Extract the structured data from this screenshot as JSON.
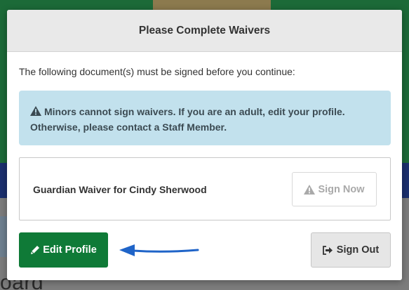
{
  "background": {
    "heading_fragment": "oard"
  },
  "modal": {
    "title": "Please Complete Waivers",
    "intro": "The following document(s) must be signed before you continue:",
    "alert": {
      "icon": "warning-icon",
      "text": "Minors cannot sign waivers. If you are an adult, edit your profile. Otherwise, please contact a Staff Member."
    },
    "waivers": [
      {
        "name": "Guardian Waiver for Cindy Sherwood",
        "action_label": "Sign Now",
        "action_icon": "warning-icon",
        "action_enabled": false
      }
    ],
    "buttons": {
      "edit_profile": {
        "label": "Edit Profile",
        "icon": "pencil-icon"
      },
      "sign_out": {
        "label": "Sign Out",
        "icon": "sign-out-icon"
      }
    },
    "annotation": {
      "icon": "arrow-left-icon",
      "color": "#1f64c8"
    }
  },
  "colors": {
    "primary_green": "#0f7a37",
    "alert_bg": "#c2e1ed",
    "header_bg": "#e9e9e9"
  }
}
